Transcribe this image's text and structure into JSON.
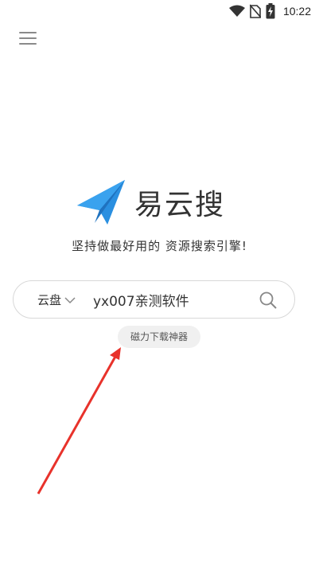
{
  "status_bar": {
    "time": "10:22",
    "icons": [
      "wifi-icon",
      "no-sim-icon",
      "battery-charging-icon"
    ]
  },
  "header": {
    "menu_icon": "hamburger-menu-icon"
  },
  "brand": {
    "name": "易云搜",
    "logo_icon": "paper-plane-icon",
    "logo_color": "#2a8fe0",
    "slogan": "坚持做最好用的 资源搜索引擎!"
  },
  "search": {
    "type_label": "云盘",
    "value": "yx007亲测软件",
    "placeholder": "",
    "search_icon": "search-icon"
  },
  "suggestions": {
    "chip_label": "磁力下载神器"
  },
  "annotation": {
    "arrow_color": "#e8322b"
  }
}
